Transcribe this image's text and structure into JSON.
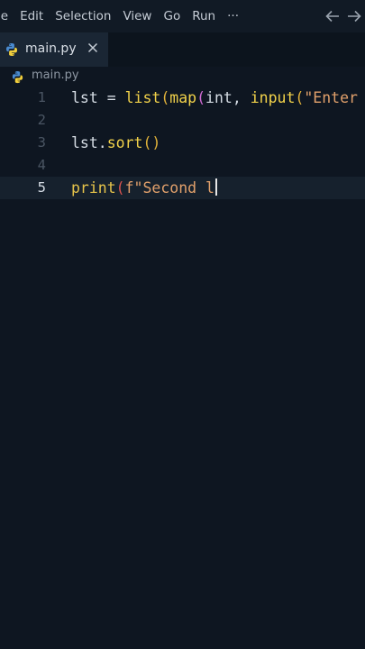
{
  "menu": {
    "items": [
      "le",
      "Edit",
      "Selection",
      "View",
      "Go",
      "Run",
      "···"
    ]
  },
  "tabs": [
    {
      "label": "main.py",
      "active": true,
      "icon": "python-icon"
    }
  ],
  "breadcrumb": {
    "file": "main.py",
    "icon": "python-icon"
  },
  "editor": {
    "active_line": 5,
    "lines": [
      {
        "number": "1",
        "text": "lst = list(map(int, input(\"Enter"
      },
      {
        "number": "2",
        "text": ""
      },
      {
        "number": "3",
        "text": "lst.sort()"
      },
      {
        "number": "4",
        "text": ""
      },
      {
        "number": "5",
        "text": "print(f\"Second l"
      }
    ]
  },
  "colors": {
    "background": "#0e1621",
    "menubar": "#111a25",
    "tab_active": "#1a2634",
    "function_yellow": "#f2d24a",
    "string_orange": "#e1a06b",
    "bracket_magenta": "#d06bd3"
  }
}
